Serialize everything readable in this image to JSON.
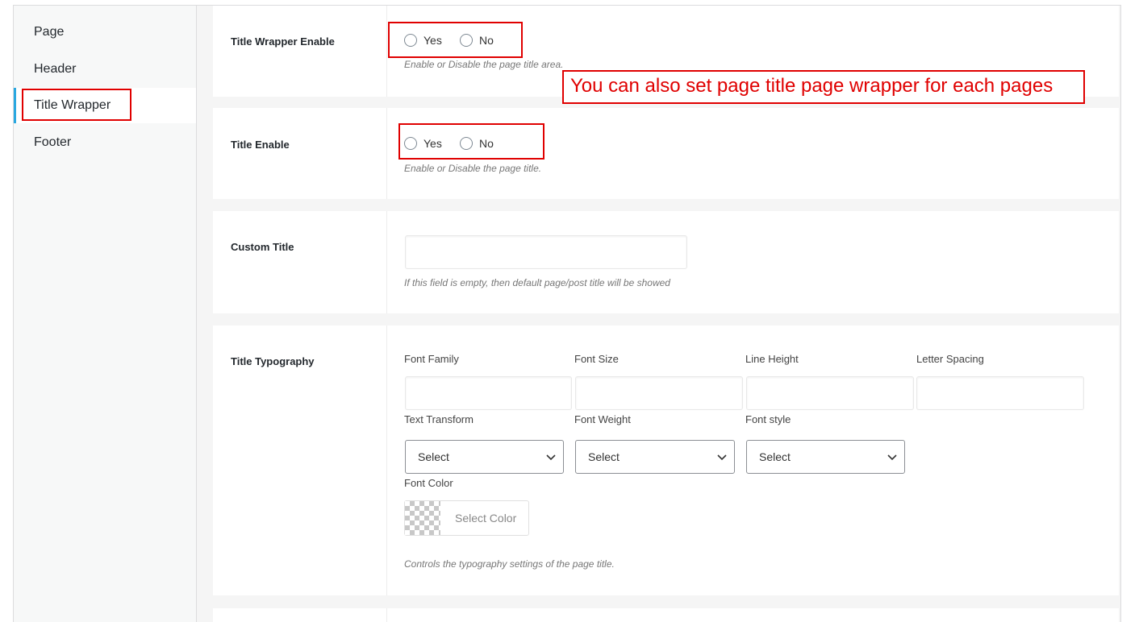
{
  "sidebar": {
    "items": [
      {
        "label": "Page",
        "active": false
      },
      {
        "label": "Header",
        "active": false
      },
      {
        "label": "Title Wrapper",
        "active": true
      },
      {
        "label": "Footer",
        "active": false
      }
    ],
    "accent_color": "#29a8e0"
  },
  "annotation": {
    "text": "You can also set page title page wrapper for each pages",
    "color": "#e00000"
  },
  "sections": {
    "title_wrapper_enable": {
      "label": "Title Wrapper Enable",
      "options": [
        "Yes",
        "No"
      ],
      "description": "Enable or Disable the page title area."
    },
    "title_enable": {
      "label": "Title Enable",
      "options": [
        "Yes",
        "No"
      ],
      "description": "Enable or Disable the page title."
    },
    "custom_title": {
      "label": "Custom Title",
      "value": "",
      "description": "If this field is empty, then default page/post title will be showed"
    },
    "title_typography": {
      "label": "Title Typography",
      "font_family_label": "Font Family",
      "font_size_label": "Font Size",
      "line_height_label": "Line Height",
      "letter_spacing_label": "Letter Spacing",
      "text_transform_label": "Text Transform",
      "font_weight_label": "Font Weight",
      "font_style_label": "Font style",
      "select_placeholder": "Select",
      "font_color_label": "Font Color",
      "select_color_label": "Select Color",
      "description": "Controls the typography settings of the page title."
    }
  }
}
